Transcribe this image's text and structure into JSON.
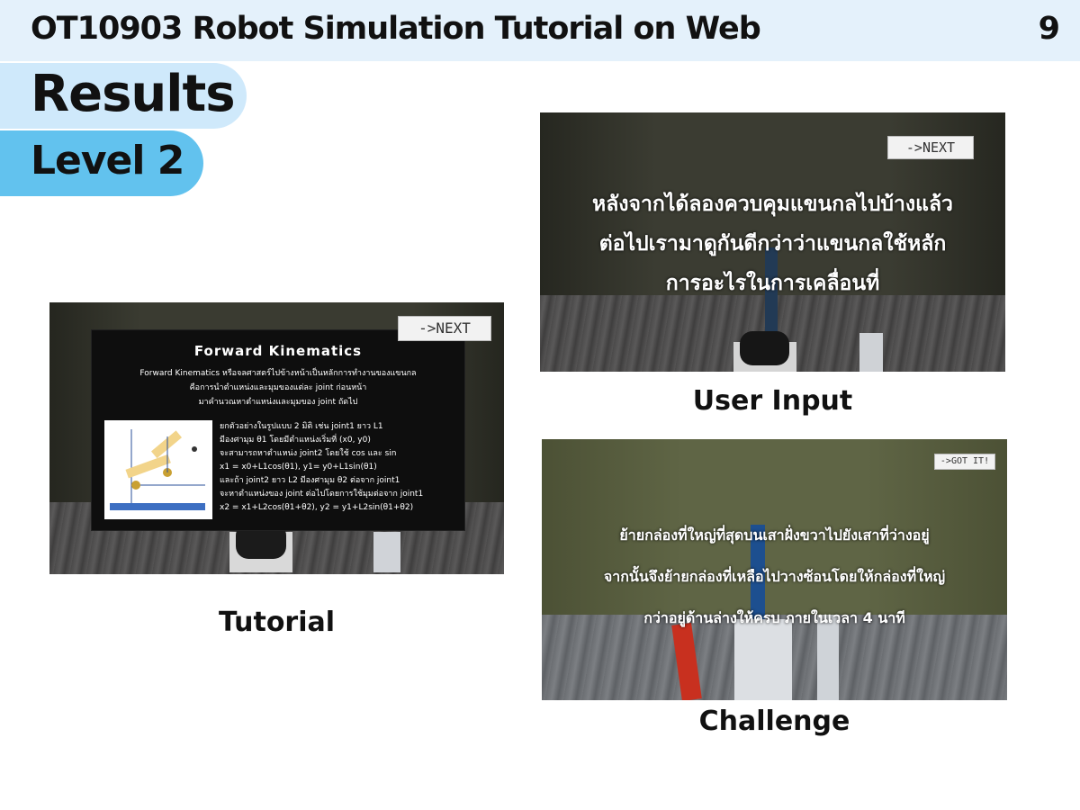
{
  "header": {
    "title": "OT10903 Robot Simulation Tutorial on Web",
    "page_number": "9"
  },
  "section": {
    "results_label": "Results",
    "level_label": "Level 2"
  },
  "tutorial": {
    "caption": "Tutorial",
    "next_button": "->NEXT",
    "panel_title": "Forward Kinematics",
    "panel_description": [
      "Forward Kinematics หรือจลศาสตร์ไปข้างหน้าเป็นหลักการทำงานของแขนกล",
      "คือการนำตำแหน่งและมุมของแต่ละ joint ก่อนหน้า",
      "มาคำนวณหาตำแหน่งและมุมของ joint ถัดไป"
    ],
    "panel_lines": [
      "ยกตัวอย่างในรูปแบบ 2 มิติ เช่น joint1 ยาว L1",
      "มีองศามุม θ1 โดยมีตำแหน่งเริ่มที่ (x0, y0)",
      "จะสามารถหาตำแหน่ง joint2 โดยใช้ cos และ sin",
      "x1 = x0+L1cos(θ1), y1= y0+L1sin(θ1)",
      "และถ้า joint2 ยาว L2 มีองศามุม θ2 ต่อจาก joint1",
      "จะหาตำแหน่งของ joint ต่อไปโดยการใช้มุมต่อจาก joint1",
      "x2 = x1+L2cos(θ1+θ2), y2 = y1+L2sin(θ1+θ2)"
    ]
  },
  "user_input": {
    "caption": "User Input",
    "next_button": "->NEXT",
    "lines": [
      "หลังจากได้ลองควบคุมแขนกลไปบ้างแล้ว",
      "ต่อไปเรามาดูกันดีกว่าว่าแขนกลใช้หลัก",
      "การอะไรในการเคลื่อนที่"
    ]
  },
  "challenge": {
    "caption": "Challenge",
    "got_it_button": "->GOT IT!",
    "lines": [
      "ย้ายกล่องที่ใหญ่ที่สุดบนเสาฝั่งขวาไปยังเสาที่ว่างอยู่",
      "จากนั้นจึงย้ายกล่องที่เหลือไปวางซ้อนโดยให้กล่องที่ใหญ่",
      "กว่าอยู่ด้านล่างให้ครบ ภายในเวลา 4 นาที"
    ]
  }
}
